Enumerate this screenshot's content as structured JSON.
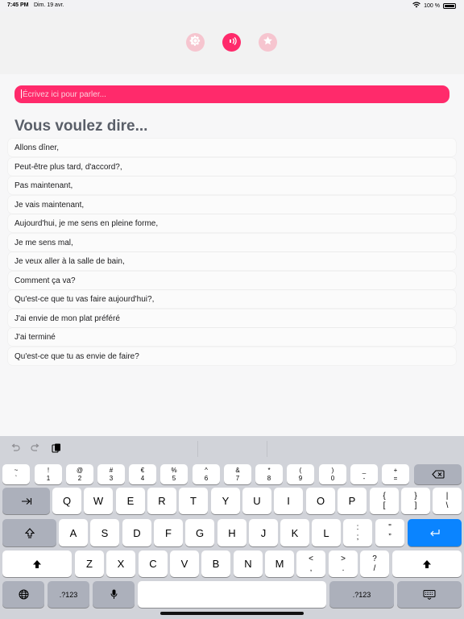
{
  "status_bar": {
    "time": "7:45 PM",
    "date": "Dim. 19 avr.",
    "battery": "100 %"
  },
  "header": {
    "buttons": [
      "gear-icon",
      "speaker-icon",
      "star-icon"
    ]
  },
  "input": {
    "placeholder": "Écrivez ici pour parler..."
  },
  "title": "Vous voulez dire...",
  "suggestions": [
    "Allons dîner,",
    "Peut-être plus tard, d'accord?,",
    "Pas maintenant,",
    "Je vais maintenant,",
    "Aujourd'hui, je me sens en pleine forme,",
    "Je me sens mal,",
    "Je veux aller à la salle de bain,",
    "Comment ça va?",
    "Qu'est-ce que tu vas faire aujourd'hui?,",
    "J'ai envie de mon plat préféré",
    "J'ai terminé",
    "Qu'est-ce que tu as envie de faire?"
  ],
  "keyboard": {
    "number_row": [
      [
        "~",
        "`"
      ],
      [
        "!",
        "1"
      ],
      [
        "@",
        "2"
      ],
      [
        "#",
        "3"
      ],
      [
        "€",
        "4"
      ],
      [
        "%",
        "5"
      ],
      [
        "^",
        "6"
      ],
      [
        "&",
        "7"
      ],
      [
        "*",
        "8"
      ],
      [
        "(",
        "9"
      ],
      [
        ")",
        "0"
      ],
      [
        "_",
        "-"
      ],
      [
        "+",
        "="
      ]
    ],
    "row1": [
      "Q",
      "W",
      "E",
      "R",
      "T",
      "Y",
      "U",
      "I",
      "O",
      "P"
    ],
    "row1_extra": [
      [
        "{",
        "["
      ],
      [
        "}",
        "]"
      ],
      [
        "|",
        "\\"
      ]
    ],
    "row2": [
      "A",
      "S",
      "D",
      "F",
      "G",
      "H",
      "J",
      "K",
      "L"
    ],
    "row2_extra": [
      [
        ":",
        ";"
      ],
      [
        "\"",
        "”"
      ]
    ],
    "row3": [
      "Z",
      "X",
      "C",
      "V",
      "B",
      "N",
      "M"
    ],
    "row3_extra": [
      [
        "<",
        ","
      ],
      [
        ">",
        "."
      ],
      [
        "?",
        "/"
      ]
    ],
    "numbers_label": ".?123"
  }
}
